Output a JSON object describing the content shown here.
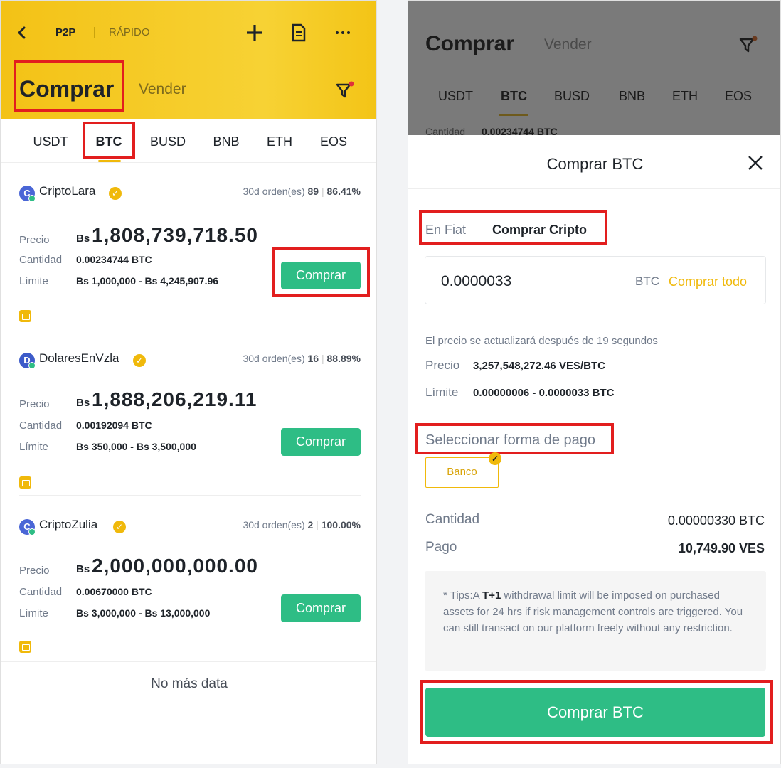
{
  "left": {
    "nav": {
      "p2p": "P2P",
      "rapido": "RÁPIDO"
    },
    "header": {
      "buy": "Comprar",
      "sell": "Vender"
    },
    "tabs": [
      "USDT",
      "BTC",
      "BUSD",
      "BNB",
      "ETH",
      "EOS"
    ],
    "active_tab": "BTC",
    "labels": {
      "price": "Precio",
      "amount": "Cantidad",
      "limit": "Límite",
      "currency": "Bs",
      "orders": "30d orden(es)",
      "buy": "Comprar"
    },
    "offers": [
      {
        "initial": "C",
        "name": "CriptoLara",
        "orders": "89",
        "rate": "86.41%",
        "price": "1,808,739,718.50",
        "amount": "0.00234744 BTC",
        "limit": "Bs 1,000,000 - Bs 4,245,907.96"
      },
      {
        "initial": "D",
        "name": "DolaresEnVzla",
        "orders": "16",
        "rate": "88.89%",
        "price": "1,888,206,219.11",
        "amount": "0.00192094 BTC",
        "limit": "Bs 350,000 - Bs 3,500,000"
      },
      {
        "initial": "C",
        "name": "CriptoZulia",
        "orders": "2",
        "rate": "100.00%",
        "price": "2,000,000,000.00",
        "amount": "0.00670000 BTC",
        "limit": "Bs 3,000,000 - Bs 13,000,000"
      }
    ],
    "footer": "No más data"
  },
  "right": {
    "bg": {
      "buy": "Comprar",
      "sell": "Vender",
      "tabs": [
        "USDT",
        "BTC",
        "BUSD",
        "BNB",
        "ETH",
        "EOS"
      ],
      "peek_label": "Cantidad",
      "peek_value": "0.00234744 BTC"
    },
    "sheet": {
      "title": "Comprar BTC",
      "mode_fiat": "En Fiat",
      "mode_crypto": "Comprar Cripto",
      "input_value": "0.0000033",
      "input_unit": "BTC",
      "buy_all": "Comprar todo",
      "refresh_note": "El precio se actualizará después de 19 segundos",
      "price_label": "Precio",
      "price_value": "3,257,548,272.46 VES/BTC",
      "limit_label": "Límite",
      "limit_value": "0.00000006 - 0.0000033 BTC",
      "payment_title": "Seleccionar forma de pago",
      "payment_option": "Banco",
      "qty_label": "Cantidad",
      "qty_value": "0.00000330 BTC",
      "pay_label": "Pago",
      "pay_value": "10,749.90 VES",
      "tips_prefix": "* Tips:A ",
      "tips_bold": "T+1",
      "tips_rest": " withdrawal limit will be imposed on purchased assets for 24 hrs if risk management controls are triggered. You can still transact on our platform freely without any restriction.",
      "submit": "Comprar BTC"
    }
  },
  "colors": {
    "brand_yellow": "#f0b90b",
    "buy_green": "#2ebd85",
    "highlight_red": "#e21e1e"
  }
}
